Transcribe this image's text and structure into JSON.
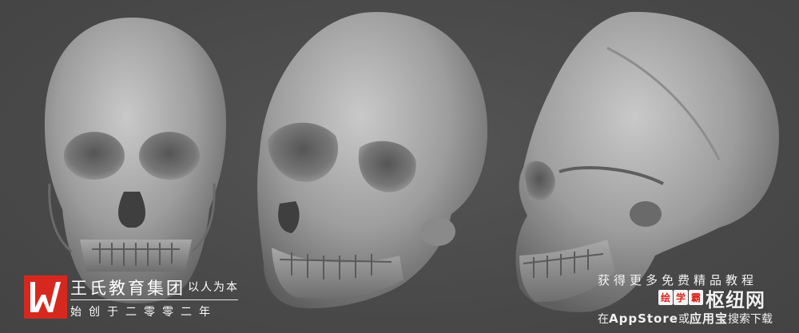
{
  "image": {
    "subject_description": "Three grey 3D-rendered human skull sculpts on a dark grey background"
  },
  "brand": {
    "logo_mark": "logo-w-icon",
    "logo_color": "#d7281f",
    "name": "王氏教育集团",
    "motto": "以人为本",
    "founded": "始创于二零零二年"
  },
  "promo": {
    "slogan": "获得更多免费精品教程",
    "app_logo_chips": [
      "绘",
      "学",
      "霸"
    ],
    "site_name": "枢纽网",
    "store_prefix": "在",
    "store_name": "AppStore",
    "store_or": "或",
    "store_alt": "应用宝",
    "store_suffix": "搜索下载"
  },
  "colors": {
    "background": "#4b4b4b",
    "skull": "#9a9a9a",
    "accent": "#d7281f"
  }
}
